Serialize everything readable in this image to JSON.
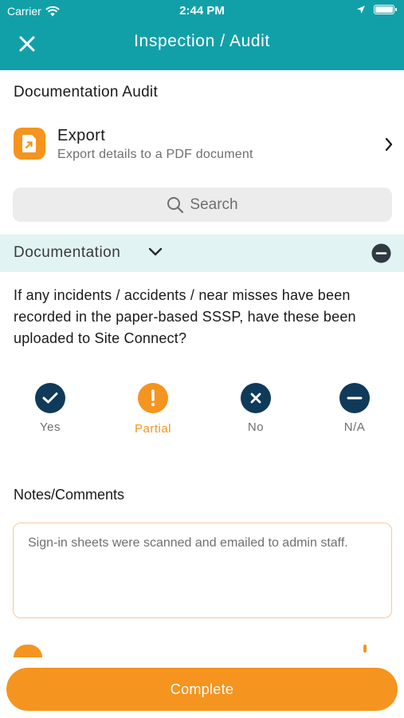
{
  "status_bar": {
    "carrier": "Carrier",
    "time": "2:44 PM"
  },
  "navbar": {
    "title": "Inspection / Audit"
  },
  "section": {
    "title": "Documentation Audit"
  },
  "export": {
    "title": "Export",
    "subtitle": "Export details to a PDF document"
  },
  "search": {
    "placeholder": "Search"
  },
  "category": {
    "label": "Documentation"
  },
  "question": {
    "text": "If any incidents / accidents / near misses have been recorded in the paper-based SSSP, have these been uploaded to Site Connect?",
    "options": [
      {
        "label": "Yes",
        "icon": "check-icon",
        "color": "#0f3a5a"
      },
      {
        "label": "Partial",
        "icon": "exclamation-icon",
        "color": "#f5941f",
        "selected": true
      },
      {
        "label": "No",
        "icon": "x-icon",
        "color": "#0f3a5a"
      },
      {
        "label": "N/A",
        "icon": "minus-icon",
        "color": "#0f3a5a"
      }
    ]
  },
  "notes": {
    "label": "Notes/Comments",
    "value": "Sign-in sheets were scanned and emailed to admin staff."
  },
  "actions": {
    "complete_label": "Complete"
  },
  "colors": {
    "teal": "#12a0a8",
    "orange": "#f5941f",
    "navy": "#0f3a5a",
    "section_bg": "#e2f3f4"
  }
}
